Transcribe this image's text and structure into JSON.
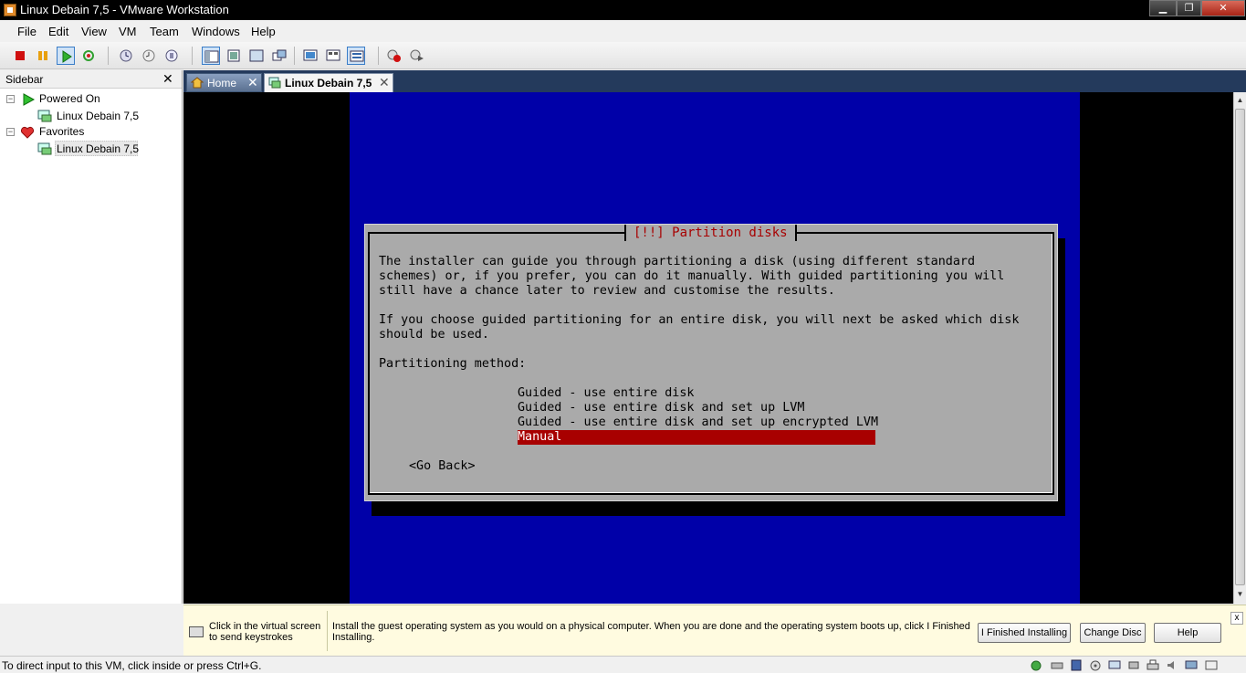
{
  "window": {
    "title": "Linux Debain 7,5 - VMware Workstation"
  },
  "menu": [
    "File",
    "Edit",
    "View",
    "VM",
    "Team",
    "Windows",
    "Help"
  ],
  "toolbar": {
    "icons": [
      "stop-icon",
      "pause-icon",
      "play-icon",
      "reset-icon",
      "snapshot-icon",
      "revert-snapshot-icon",
      "snapshot-manager-icon",
      "show-sidebar-icon",
      "fit-guest-icon",
      "full-screen-icon",
      "unity-icon",
      "console-view-icon",
      "thumbnail-view-icon",
      "summary-view-icon",
      "record-icon",
      "replay-icon"
    ]
  },
  "sidebar": {
    "title": "Sidebar",
    "close": "✕",
    "groups": [
      {
        "label": "Powered On",
        "toggle": "−",
        "items": [
          {
            "label": "Linux Debain 7,5"
          }
        ]
      },
      {
        "label": "Favorites",
        "toggle": "−",
        "items": [
          {
            "label": "Linux Debain 7,5"
          }
        ]
      }
    ]
  },
  "tabs": [
    {
      "label": "Home",
      "close": "✕"
    },
    {
      "label": "Linux Debain 7,5",
      "close": "✕"
    }
  ],
  "installer": {
    "title": "[!!] Partition disks",
    "para1": [
      "The installer can guide you through partitioning a disk (using different standard",
      "schemes) or, if you prefer, you can do it manually. With guided partitioning you will",
      "still have a chance later to review and customise the results."
    ],
    "para2": [
      "If you choose guided partitioning for an entire disk, you will next be asked which disk",
      "should be used."
    ],
    "method_label": "Partitioning method:",
    "options": [
      "Guided - use entire disk",
      "Guided - use entire disk and set up LVM",
      "Guided - use entire disk and set up encrypted LVM",
      "Manual"
    ],
    "selected_option_index": 3,
    "go_back": "<Go Back>"
  },
  "hint_bar": {
    "left_text": "Click in the virtual screen to send keystrokes",
    "main_text": "Install the guest operating system as you would on a physical computer. When you are done and the operating system boots up, click I Finished Installing.",
    "buttons": [
      "I Finished Installing",
      "Change Disc",
      "Help"
    ],
    "close": "x"
  },
  "status_bar": {
    "text": "To direct input to this VM, click inside or press Ctrl+G.",
    "icons": [
      "vmware-tools-icon",
      "hard-disk-icon",
      "floppy-icon",
      "cd-rom-icon",
      "network-icon",
      "usb-icon",
      "printer-icon",
      "sound-icon",
      "display-icon",
      "message-icon"
    ]
  },
  "colors": {
    "installer_background": "#0000a8",
    "dialog_background": "#aaaaaa",
    "selection": "#a80000",
    "tab_bar": "#243a5c",
    "hint_background": "#fffbe0"
  }
}
